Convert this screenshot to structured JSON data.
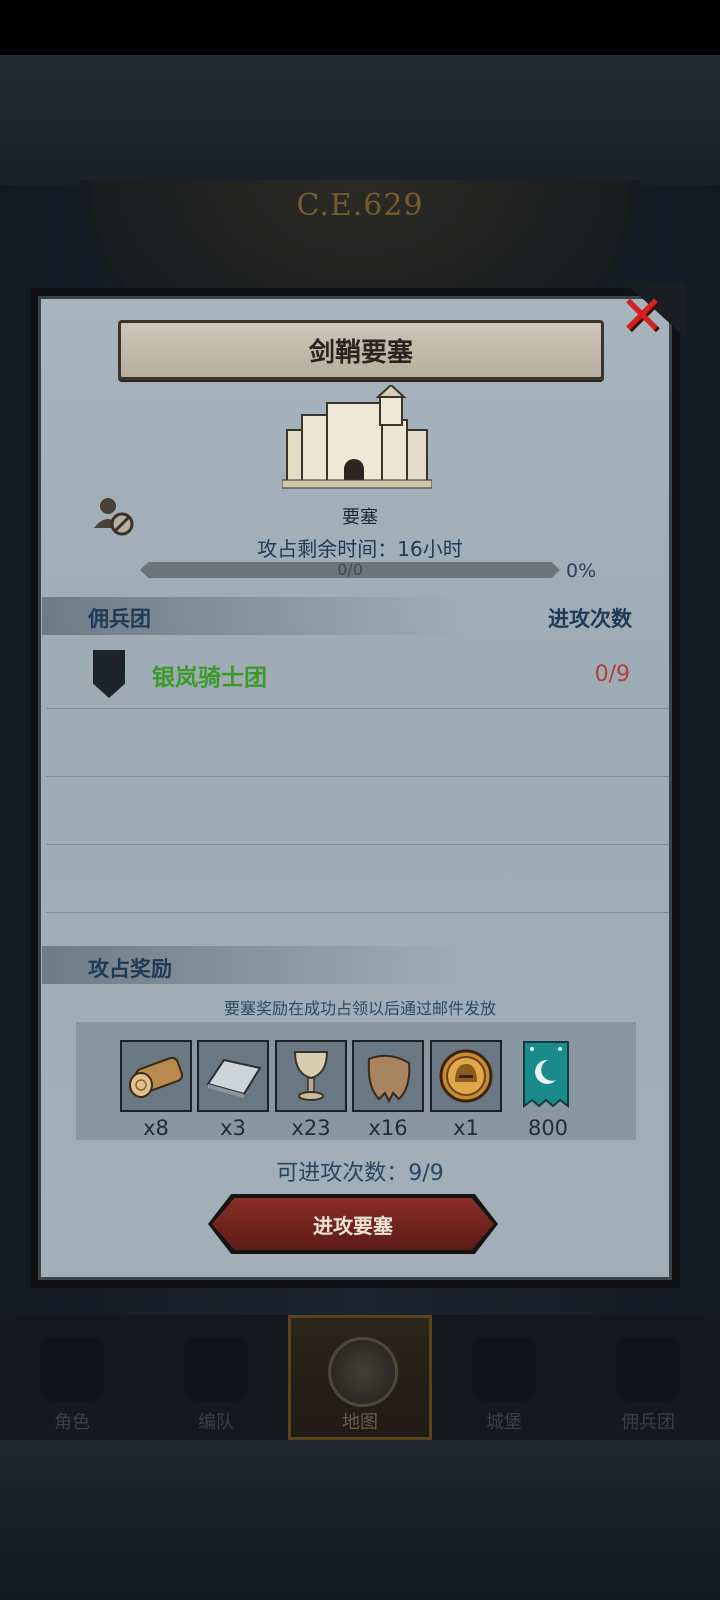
{
  "background": {
    "era_label": "C.E.629"
  },
  "dialog": {
    "title": "剑鞘要塞",
    "building_type": "要塞",
    "timer_text": "攻占剩余时间：16小时",
    "progress": {
      "text": "0/0",
      "percent_label": "0%",
      "fraction": 0
    },
    "columns": {
      "left": "佣兵团",
      "right": "进攻次数"
    },
    "guilds": [
      {
        "name": "银岚骑士团",
        "attacks": "0/9"
      }
    ],
    "rewards_title": "攻占奖励",
    "rewards_note": "要塞奖励在成功占领以后通过邮件发放",
    "rewards": [
      {
        "icon": "wood-log-icon",
        "qty": "x8"
      },
      {
        "icon": "iron-ingot-icon",
        "qty": "x3"
      },
      {
        "icon": "goblet-icon",
        "qty": "x23"
      },
      {
        "icon": "pelt-icon",
        "qty": "x16"
      },
      {
        "icon": "knight-helmet-coin-icon",
        "qty": "x1"
      },
      {
        "icon": "guild-banner-icon",
        "qty": "800"
      }
    ],
    "attack_count_text": "可进攻次数：9/9",
    "attack_button": "进攻要塞"
  },
  "nav": {
    "items": [
      {
        "label": "角色"
      },
      {
        "label": "编队"
      },
      {
        "label": "地图",
        "active": true
      },
      {
        "label": "城堡"
      },
      {
        "label": "佣兵团"
      }
    ]
  },
  "colors": {
    "guild_name": "#3d9a2a",
    "attack_count_red": "#b0403d",
    "close_red": "#d4211c",
    "attack_button": "#7a2620"
  }
}
